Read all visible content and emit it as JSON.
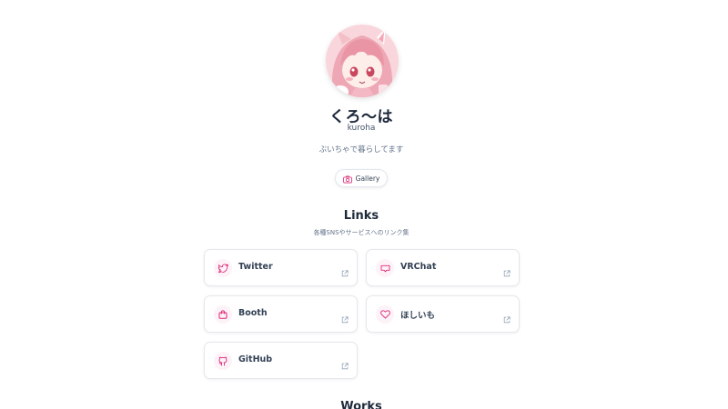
{
  "profile": {
    "name": "くろ〜は",
    "handle": "kuroha",
    "bio": "ぶいちゃで暮らしてます",
    "gallery_label": "Gallery"
  },
  "links_section": {
    "title": "Links",
    "subtitle": "各種SNSやサービスへのリンク集",
    "items": [
      {
        "label": "Twitter",
        "icon": "twitter-icon"
      },
      {
        "label": "VRChat",
        "icon": "vrchat-icon"
      },
      {
        "label": "Booth",
        "icon": "booth-bag-icon"
      },
      {
        "label": "ほしいも",
        "icon": "heart-icon"
      },
      {
        "label": "GitHub",
        "icon": "github-icon"
      }
    ]
  },
  "works_section": {
    "title": "Works"
  },
  "colors": {
    "accent": "#db2777",
    "text": "#334155",
    "muted": "#64748b",
    "card_border": "#e5e7eb"
  }
}
